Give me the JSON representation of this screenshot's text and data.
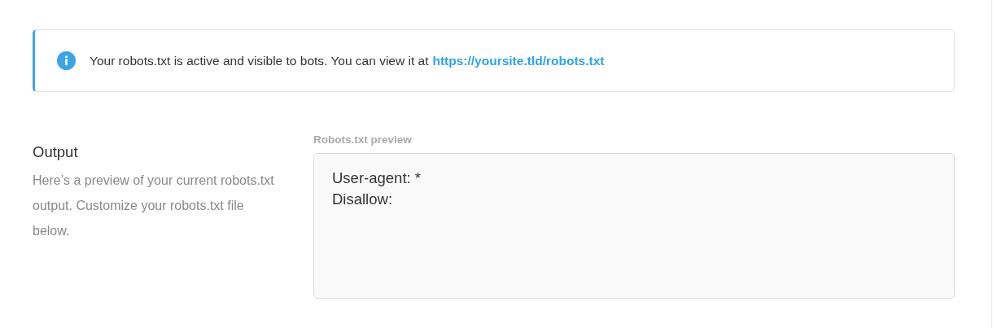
{
  "notice": {
    "text": "Your robots.txt is active and visible to bots. You can view it at",
    "link": "https://yoursite.tld/robots.txt"
  },
  "output": {
    "title": "Output",
    "description": "Here’s a preview of your current robots.txt output. Customize your robots.txt file below.",
    "preview_label": "Robots.txt preview",
    "preview_value": "User-agent: *\nDisallow:"
  }
}
